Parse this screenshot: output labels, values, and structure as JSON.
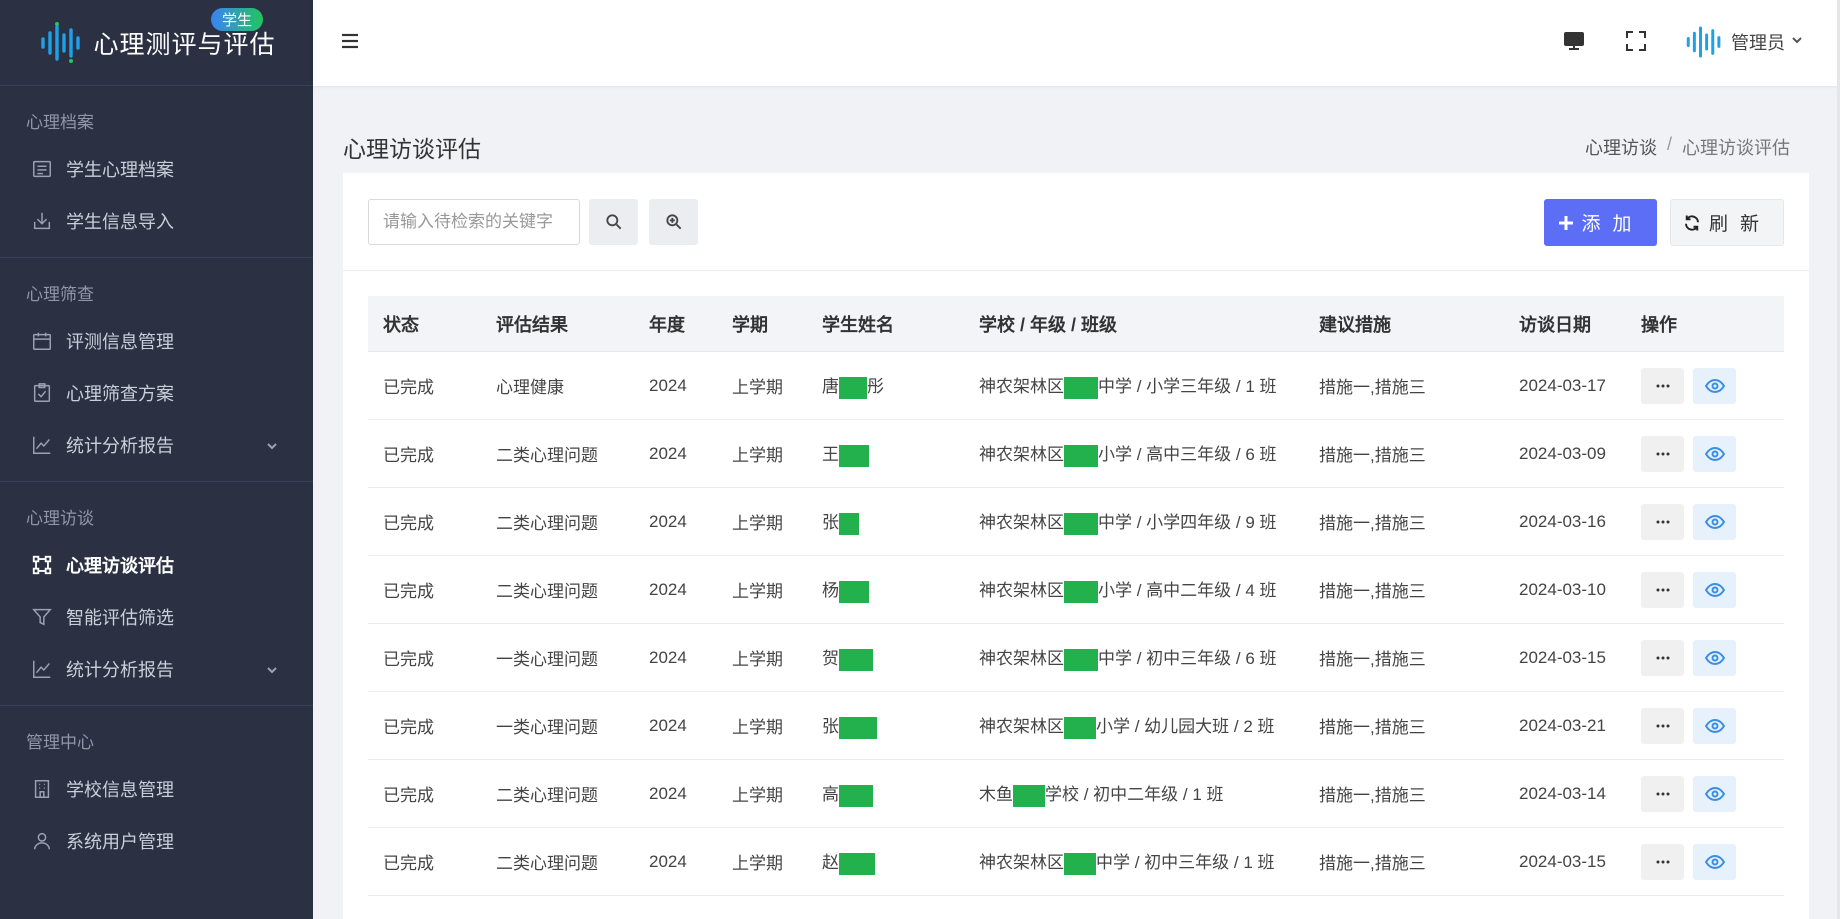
{
  "brand": {
    "title": "心理测评与评估",
    "badge": "学生"
  },
  "sidebar": {
    "sections": [
      {
        "title": "心理档案",
        "items": [
          {
            "label": "学生心理档案",
            "icon": "document-icon"
          },
          {
            "label": "学生信息导入",
            "icon": "import-icon"
          }
        ]
      },
      {
        "title": "心理筛查",
        "items": [
          {
            "label": "评测信息管理",
            "icon": "calendar-icon"
          },
          {
            "label": "心理筛查方案",
            "icon": "clipboard-check-icon"
          },
          {
            "label": "统计分析报告",
            "icon": "line-chart-icon"
          }
        ]
      },
      {
        "title": "心理访谈",
        "items": [
          {
            "label": "心理访谈评估",
            "icon": "scan-icon"
          },
          {
            "label": "智能评估筛选",
            "icon": "filter-icon"
          },
          {
            "label": "统计分析报告",
            "icon": "line-chart-icon"
          }
        ]
      },
      {
        "title": "管理中心",
        "items": [
          {
            "label": "学校信息管理",
            "icon": "building-icon"
          },
          {
            "label": "系统用户管理",
            "icon": "user-icon"
          }
        ]
      }
    ]
  },
  "header": {
    "username": "管理员"
  },
  "page": {
    "title": "心理访谈评估",
    "breadcrumb": [
      "心理访谈",
      "/",
      "心理访谈评估"
    ]
  },
  "toolbar": {
    "search_placeholder": "请输入待检索的关键字",
    "add_label": "添加",
    "refresh_label": "刷新"
  },
  "table": {
    "headers": [
      "状态",
      "评估结果",
      "年度",
      "学期",
      "学生姓名",
      "学校 / 年级 / 班级",
      "建议措施",
      "访谈日期",
      "操作"
    ],
    "rows": [
      {
        "status": "已完成",
        "result": "心理健康",
        "year": "2024",
        "term": "上学期",
        "name_prefix": "唐",
        "name_suffix": "彤",
        "school_prefix": "神农架林区",
        "school_suffix": "中学 / 小学三年级 / 1 班",
        "measures": "措施一,措施三",
        "date": "2024-03-17"
      },
      {
        "status": "已完成",
        "result": "二类心理问题",
        "year": "2024",
        "term": "上学期",
        "name_prefix": "王",
        "name_suffix": "",
        "school_prefix": "神农架林区",
        "school_suffix": "小学 / 高中三年级 / 6 班",
        "measures": "措施一,措施三",
        "date": "2024-03-09"
      },
      {
        "status": "已完成",
        "result": "二类心理问题",
        "year": "2024",
        "term": "上学期",
        "name_prefix": "张",
        "name_suffix": "",
        "school_prefix": "神农架林区",
        "school_suffix": "中学 / 小学四年级 / 9 班",
        "measures": "措施一,措施三",
        "date": "2024-03-16"
      },
      {
        "status": "已完成",
        "result": "二类心理问题",
        "year": "2024",
        "term": "上学期",
        "name_prefix": "杨",
        "name_suffix": "",
        "school_prefix": "神农架林区",
        "school_suffix": "小学 / 高中二年级 / 4 班",
        "measures": "措施一,措施三",
        "date": "2024-03-10"
      },
      {
        "status": "已完成",
        "result": "一类心理问题",
        "year": "2024",
        "term": "上学期",
        "name_prefix": "贺",
        "name_suffix": "",
        "school_prefix": "神农架林区",
        "school_suffix": "中学 / 初中三年级 / 6 班",
        "measures": "措施一,措施三",
        "date": "2024-03-15"
      },
      {
        "status": "已完成",
        "result": "一类心理问题",
        "year": "2024",
        "term": "上学期",
        "name_prefix": "张",
        "name_suffix": "",
        "school_prefix": "神农架林区",
        "school_suffix": "小学 / 幼儿园大班 / 2 班",
        "measures": "措施一,措施三",
        "date": "2024-03-21"
      },
      {
        "status": "已完成",
        "result": "二类心理问题",
        "year": "2024",
        "term": "上学期",
        "name_prefix": "高",
        "name_suffix": "",
        "school_prefix": "木鱼",
        "school_suffix": "学校 / 初中二年级 / 1 班",
        "measures": "措施一,措施三",
        "date": "2024-03-14"
      },
      {
        "status": "已完成",
        "result": "二类心理问题",
        "year": "2024",
        "term": "上学期",
        "name_prefix": "赵",
        "name_suffix": "",
        "school_prefix": "神农架林区",
        "school_suffix": "中学 / 初中三年级 / 1 班",
        "measures": "措施一,措施三",
        "date": "2024-03-15"
      }
    ]
  },
  "colors": {
    "sidebar_bg": "#2b3143",
    "primary": "#5b6ef5",
    "redaction": "#22b14c",
    "view_icon": "#3a8ee6"
  }
}
